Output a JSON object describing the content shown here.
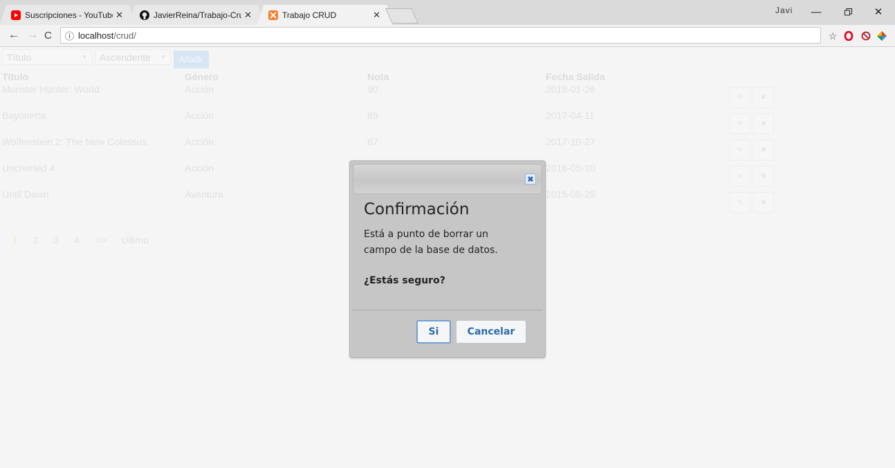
{
  "browser": {
    "tabs": [
      {
        "title": "Suscripciones - YouTube",
        "favicon": "youtube-icon"
      },
      {
        "title": "JavierReina/Trabajo-Crud",
        "favicon": "github-icon"
      },
      {
        "title": "Trabajo CRUD",
        "favicon": "xampp-icon",
        "active": true
      }
    ],
    "close_glyph": "✕",
    "profile": "Javi",
    "url_host": "localhost",
    "url_path": "/crud/",
    "colors": {
      "youtube": "#ff0000",
      "xampp": "#fb7a24",
      "opera": "#e0001b"
    }
  },
  "controls": {
    "sort_field": "Título",
    "sort_order": "Ascendente",
    "add_label": "Añadir"
  },
  "table": {
    "headers": {
      "title": "Título",
      "genre": "Género",
      "score": "Nota",
      "date": "Fecha Salida"
    },
    "rows": [
      {
        "title": "Monster Hunter: World",
        "genre": "Acción",
        "score": "90",
        "date": "2018-01-26"
      },
      {
        "title": "Bayonetta",
        "genre": "Acción",
        "score": "89",
        "date": "2017-04-11"
      },
      {
        "title": "Wolfenstein 2: The New Colossus",
        "genre": "Acción",
        "score": "87",
        "date": "2017-10-27"
      },
      {
        "title": "Uncharted 4",
        "genre": "Acción",
        "score": "",
        "date": "2016-05-10"
      },
      {
        "title": "Until Dawn",
        "genre": "Aventura",
        "score": "",
        "date": "2015-08-25"
      }
    ]
  },
  "pagination": {
    "pages": [
      "1",
      "2",
      "3",
      "4"
    ],
    "current": "1",
    "next": ">>",
    "last": "Ultimo"
  },
  "modal": {
    "title": "Confirmación",
    "message": "Está a punto de borrar un campo de la base de datos.",
    "question": "¿Estás seguro?",
    "confirm_label": "Si",
    "cancel_label": "Cancelar",
    "close_glyph": "✖"
  }
}
